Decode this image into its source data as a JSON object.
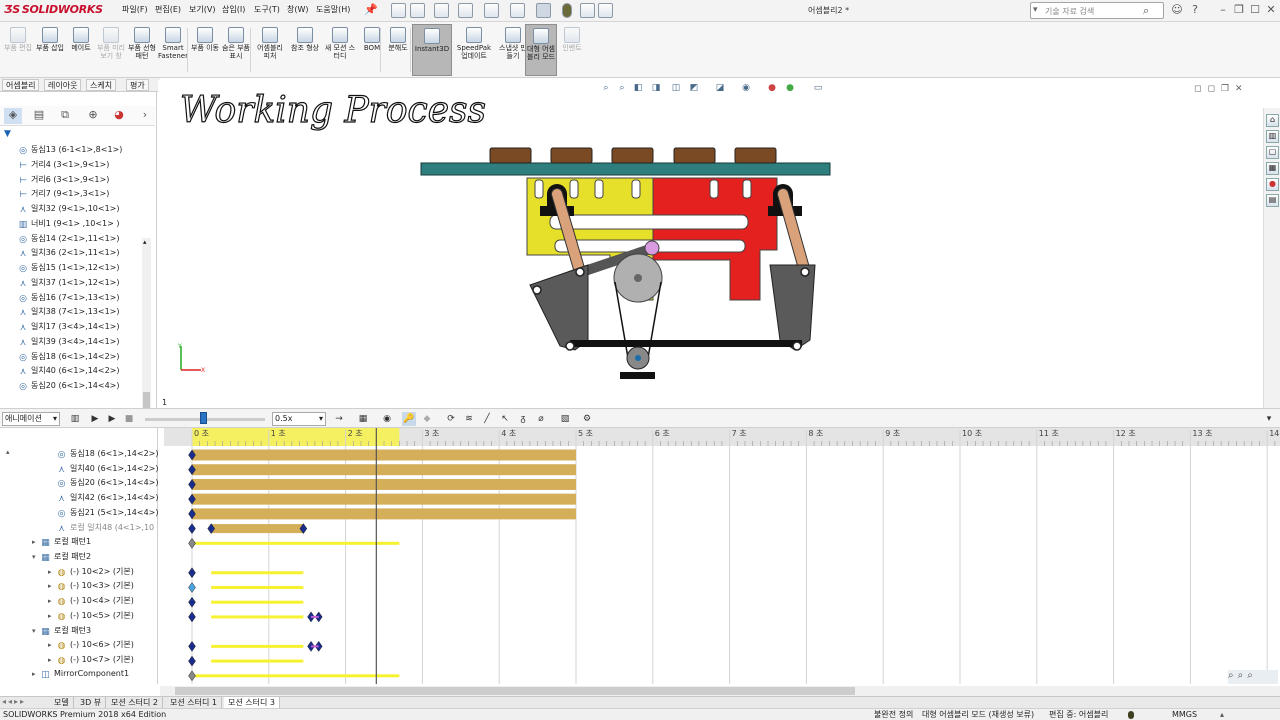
{
  "app": {
    "logo": "SOLIDWORKS",
    "document_title": "어셈블리2 *"
  },
  "menu": [
    "파일(F)",
    "편집(E)",
    "보기(V)",
    "삽입(I)",
    "도구(T)",
    "창(W)",
    "도움말(H)"
  ],
  "search": {
    "placeholder": "기술 자료 검색"
  },
  "ribbon": [
    {
      "label": "부품 편집",
      "disabled": true
    },
    {
      "label": "부품 삽입",
      "disabled": false
    },
    {
      "label": "메이트",
      "disabled": false
    },
    {
      "label": "부품 미리보기 창",
      "disabled": true
    },
    {
      "label": "부품 선형 패턴",
      "disabled": false
    },
    {
      "label": "Smart Fastener",
      "disabled": false
    },
    {
      "label": "부품 이동",
      "disabled": false
    },
    {
      "label": "숨은 부품 표시",
      "disabled": false
    },
    {
      "label": "어셈블리 피처",
      "disabled": false
    },
    {
      "label": "참조 형상",
      "disabled": false
    },
    {
      "label": "새 모션 스터디",
      "disabled": false
    },
    {
      "label": "BOM",
      "disabled": false
    },
    {
      "label": "분해도",
      "disabled": false
    },
    {
      "label": "Instant3D",
      "disabled": false,
      "active": true
    },
    {
      "label": "SpeedPak 업데이트",
      "disabled": false
    },
    {
      "label": "스냅샷 만들기",
      "disabled": false
    },
    {
      "label": "대형 어셈블리 모드",
      "disabled": false,
      "active": true
    },
    {
      "label": "인벤트",
      "disabled": true
    }
  ],
  "command_tabs": [
    "어셈블리",
    "레이아웃",
    "스케치",
    "평가"
  ],
  "feature_tree": [
    {
      "type": "concentric",
      "label": "동심13 (6-1<1>,8<1>)"
    },
    {
      "type": "distance",
      "label": "거리4 (3<1>,9<1>)"
    },
    {
      "type": "distance",
      "label": "거리6 (3<1>,9<1>)"
    },
    {
      "type": "distance",
      "label": "거리7 (9<1>,3<1>)"
    },
    {
      "type": "coincident",
      "label": "일치32 (9<1>,10<1>)"
    },
    {
      "type": "width",
      "label": "너비1 (9<1> ,10<1> )"
    },
    {
      "type": "concentric",
      "label": "동심14 (2<1>,11<1>)"
    },
    {
      "type": "coincident",
      "label": "일치36 (2<1>,11<1>)"
    },
    {
      "type": "concentric",
      "label": "동심15 (1<1>,12<1>)"
    },
    {
      "type": "coincident",
      "label": "일치37 (1<1>,12<1>)"
    },
    {
      "type": "concentric",
      "label": "동심16 (7<1>,13<1>)"
    },
    {
      "type": "coincident",
      "label": "일치38 (7<1>,13<1>)"
    },
    {
      "type": "coincident",
      "label": "일치17 (3<4>,14<1>)"
    },
    {
      "type": "coincident",
      "label": "일치39 (3<4>,14<1>)"
    },
    {
      "type": "concentric",
      "label": "동심18 (6<1>,14<2>)"
    },
    {
      "type": "coincident",
      "label": "일치40 (6<1>,14<2>)"
    },
    {
      "type": "concentric",
      "label": "동심20 (6<1>,14<4>)"
    }
  ],
  "viewport": {
    "overlay_text": "Working Process",
    "page_marker": "1"
  },
  "motion": {
    "study_type": "애니메이션",
    "speed": "0.5x",
    "time_labels": [
      "0 초",
      "1 초",
      "2 초",
      "3 초",
      "4 초",
      "5 초",
      "6 초",
      "7 초",
      "8 초",
      "9 초",
      "10 초",
      "11 초",
      "12 초",
      "13 초",
      "14"
    ],
    "current_time_sec": 2.4,
    "shaded_until_sec": 2.7,
    "tree": [
      {
        "indent": 1,
        "type": "concentric",
        "label": "동심18 (6<1>,14<2>)"
      },
      {
        "indent": 1,
        "type": "coincident",
        "label": "일치40 (6<1>,14<2>)"
      },
      {
        "indent": 1,
        "type": "concentric",
        "label": "동심20 (6<1>,14<4>)"
      },
      {
        "indent": 1,
        "type": "coincident",
        "label": "일치42 (6<1>,14<4>)"
      },
      {
        "indent": 1,
        "type": "concentric",
        "label": "동심21 (5<1>,14<4>)"
      },
      {
        "indent": 1,
        "type": "coincident-dim",
        "label": "로컬 일치48 (4<1>,10"
      },
      {
        "indent": 0,
        "type": "pattern",
        "label": "로컬 패턴1",
        "arrow": "▸"
      },
      {
        "indent": 0,
        "type": "pattern",
        "label": "로컬 패턴2",
        "arrow": "▾"
      },
      {
        "indent": 1,
        "type": "part",
        "label": "(-) 10<2> (기본)",
        "arrow": "▸"
      },
      {
        "indent": 1,
        "type": "part",
        "label": "(-) 10<3> (기본)",
        "arrow": "▸"
      },
      {
        "indent": 1,
        "type": "part",
        "label": "(-) 10<4> (기본)",
        "arrow": "▸"
      },
      {
        "indent": 1,
        "type": "part",
        "label": "(-) 10<5> (기본)",
        "arrow": "▸"
      },
      {
        "indent": 0,
        "type": "pattern",
        "label": "로컬 패턴3",
        "arrow": "▾"
      },
      {
        "indent": 1,
        "type": "part",
        "label": "(-) 10<6> (기본)",
        "arrow": "▸"
      },
      {
        "indent": 1,
        "type": "part",
        "label": "(-) 10<7> (기본)",
        "arrow": "▸"
      },
      {
        "indent": 0,
        "type": "mirror",
        "label": "MirrorComponent1",
        "arrow": "▸"
      }
    ]
  },
  "bottom_tabs": [
    {
      "label": "모델",
      "selected": false
    },
    {
      "label": "3D 뷰",
      "selected": false
    },
    {
      "label": "모션 스터디 2",
      "selected": false
    },
    {
      "label": "모션 스터디 1",
      "selected": false
    },
    {
      "label": "모션 스터디 3",
      "selected": true
    }
  ],
  "status": {
    "edition": "SOLIDWORKS Premium 2018 x64 Edition",
    "definition": "불완전 정의",
    "mode": "대형 어셈블리 모드 (재생성 보류)",
    "editing": "편집 중: 어셈블리",
    "units": "MMGS"
  },
  "colors": {
    "accent": "#1a62b5",
    "mate_bar": "#d4ae59",
    "key_bar": "#f7f230",
    "key_diamond": "#1a2d8c"
  }
}
